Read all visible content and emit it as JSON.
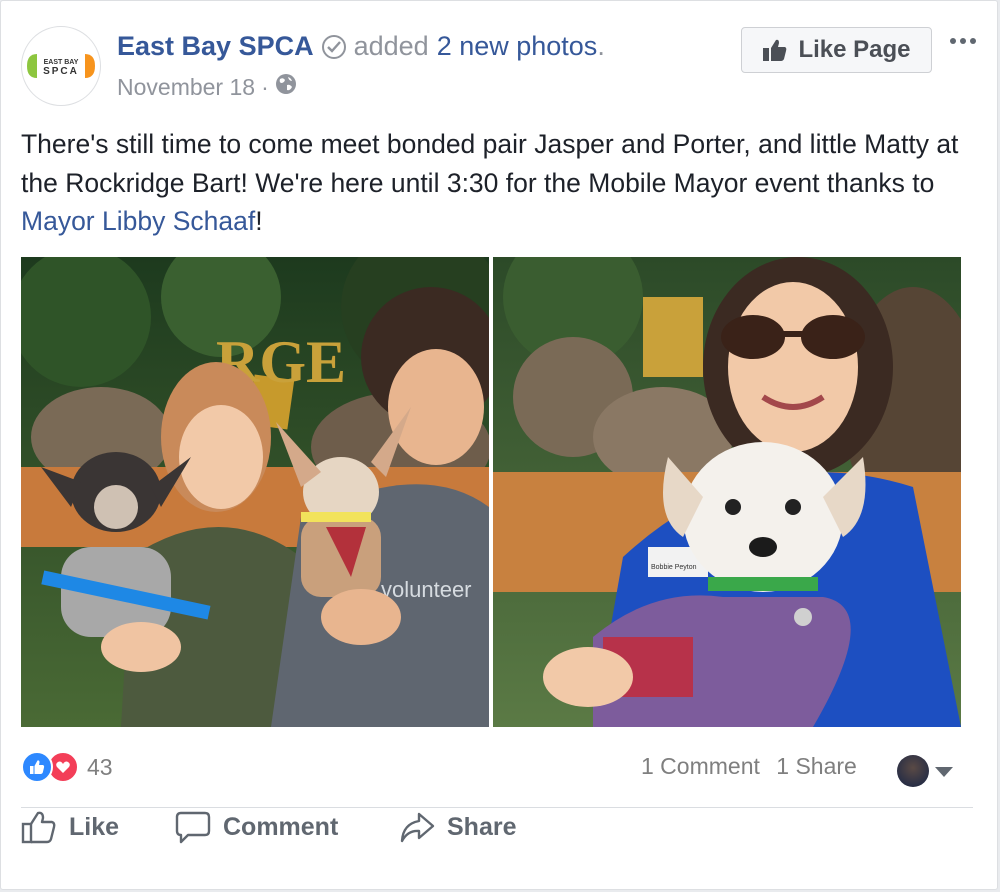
{
  "post": {
    "page_name": "East Bay SPCA",
    "action_text": "added",
    "action_link": "2 new photos",
    "action_suffix": ".",
    "date": "November 18",
    "meta_separator": "·",
    "like_page_label": "Like Page",
    "text_before_link": "There's still time to come meet bonded pair Jasper and Porter, and little Matty at the Rockridge Bart! We're here until 3:30 for the Mobile Mayor event thanks to ",
    "text_link": "Mayor Libby Schaaf",
    "text_after_link": "!"
  },
  "logo": {
    "line1": "EAST BAY",
    "line2": "SPCA"
  },
  "photos": {
    "left_sign": "RGE",
    "left_shirt": "volunteer",
    "right_badge": "Bobbie Peyton"
  },
  "footer": {
    "reaction_count": "43",
    "comments": "1 Comment",
    "shares": "1 Share",
    "like_label": "Like",
    "comment_label": "Comment",
    "share_label": "Share"
  },
  "colors": {
    "link": "#365899",
    "muted": "#90949c",
    "like_reaction": "#2d88ff",
    "love_reaction": "#f33e58",
    "brand_green": "#8dc63f",
    "brand_orange": "#f7941d"
  }
}
